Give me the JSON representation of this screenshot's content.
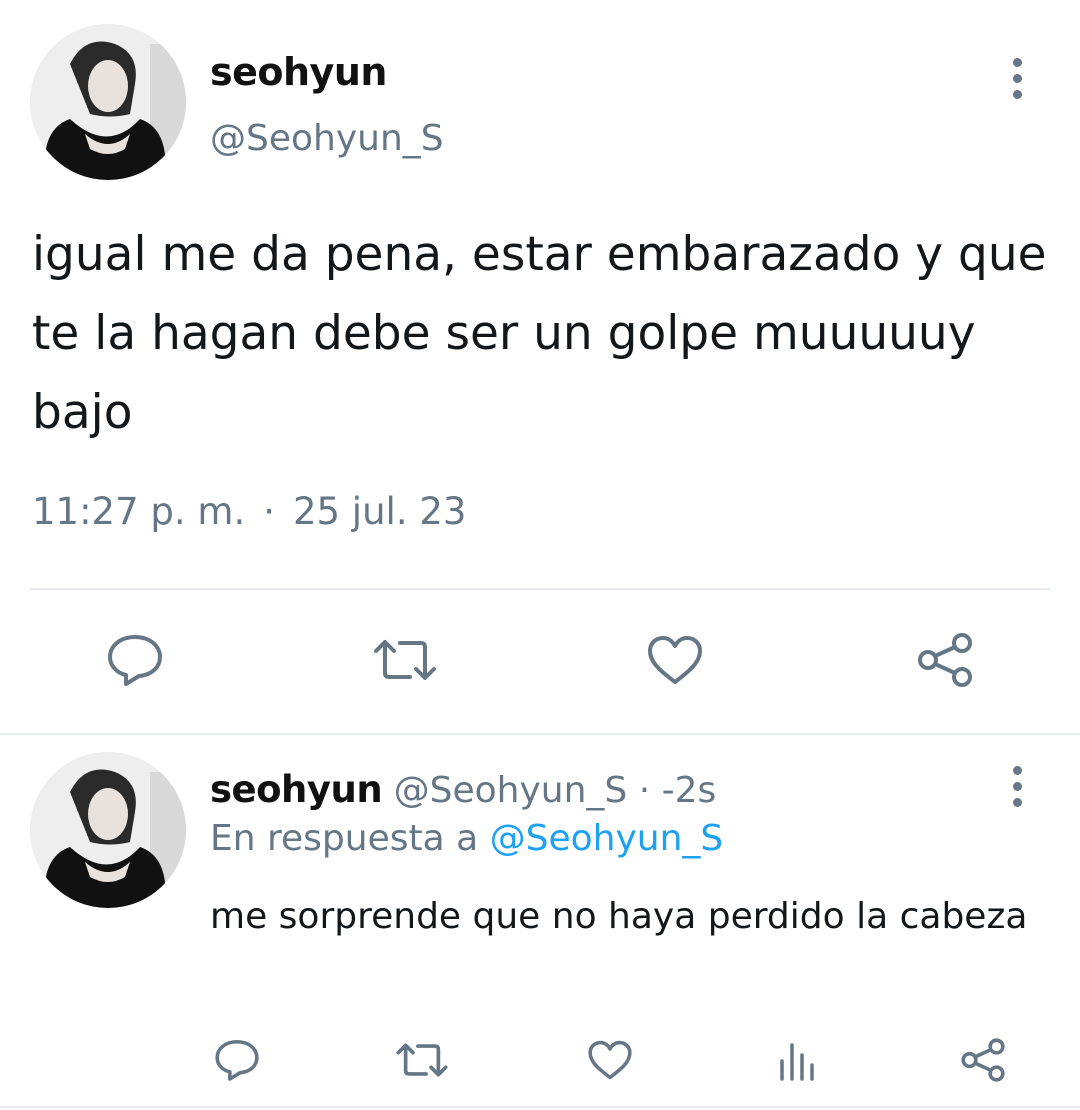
{
  "main_tweet": {
    "author_name": "seohyun",
    "author_handle": "@Seohyun_S",
    "text": "igual me da pena, estar embarazado y que te la hagan debe ser un golpe muuuuuy bajo",
    "time": "11:27 p. m.",
    "separator": "·",
    "date": "25 jul. 23",
    "actions": [
      "reply-icon",
      "retweet-icon",
      "like-icon",
      "share-icon"
    ]
  },
  "reply_tweet": {
    "author_name": "seohyun",
    "author_handle": "@Seohyun_S",
    "separator": "·",
    "age": "-2s",
    "reply_prefix": "En respuesta a",
    "reply_mention": "@Seohyun_S",
    "text": "me sorprende que no haya perdido la cabeza",
    "actions": [
      "reply-icon",
      "retweet-icon",
      "like-icon",
      "analytics-icon",
      "share-icon"
    ]
  },
  "colors": {
    "text": "#14171a",
    "secondary": "#657786",
    "link": "#1da1f2",
    "divider": "#e6ecf0"
  }
}
